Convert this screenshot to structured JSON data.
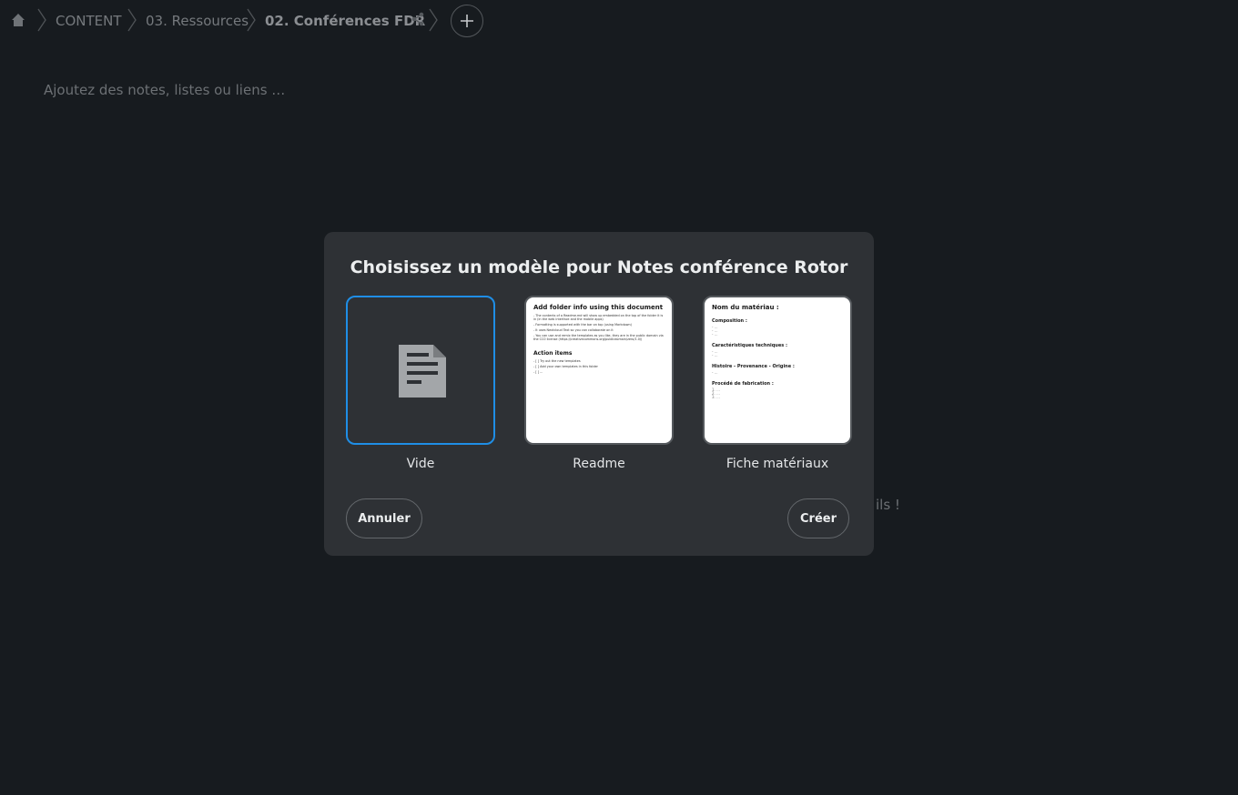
{
  "breadcrumb": {
    "items": [
      "CONTENT",
      "03. Ressources"
    ],
    "current": "02. Conférences FDR"
  },
  "main": {
    "notes_placeholder": "Ajoutez des notes, listes ou liens …",
    "background_hint": "ils !"
  },
  "modal": {
    "title": "Choisissez un modèle pour Notes conférence Rotor",
    "templates": [
      {
        "label": "Vide",
        "selected": true,
        "icon": "document-icon"
      },
      {
        "label": "Readme",
        "preview": {
          "heading": "Add folder info using this document",
          "lines": [
            "- The contents of a Readme.md will show up embedded on the top of the folder it is in (in the web interface and the mobile apps)",
            "- Formatting is supported with the bar on top (using Markdown)",
            "- It uses Nextcloud Text so you can collaborate on it",
            "- You can use and remix the templates as you like, they are in the public domain via the CC0 license (https://creativecommons.org/publicdomain/zero/1.0/)"
          ],
          "section": "Action items",
          "items": [
            "- [ ] Try out the new templates",
            "- [ ] Add your own templates in this folder",
            "- [ ] ..."
          ]
        }
      },
      {
        "label": "Fiche matériaux",
        "preview": {
          "heading": "Nom du matériau :",
          "sections": [
            {
              "title": "Composition :",
              "lines": [
                "- ...",
                "- ...",
                "- ..."
              ]
            },
            {
              "title": "Caractéristiques techniques :",
              "lines": [
                "- ...",
                "- ..."
              ]
            },
            {
              "title": "Histoire - Provenance - Origine :",
              "lines": [
                "- ..."
              ]
            },
            {
              "title": "Procédé de fabrication :",
              "lines": [
                "1. ...",
                "2. ...",
                "3. ..."
              ]
            }
          ]
        }
      }
    ],
    "cancel_label": "Annuler",
    "create_label": "Créer"
  },
  "colors": {
    "background": "#171b1f",
    "modal": "#2e3135",
    "selection": "#1f8ee6"
  }
}
